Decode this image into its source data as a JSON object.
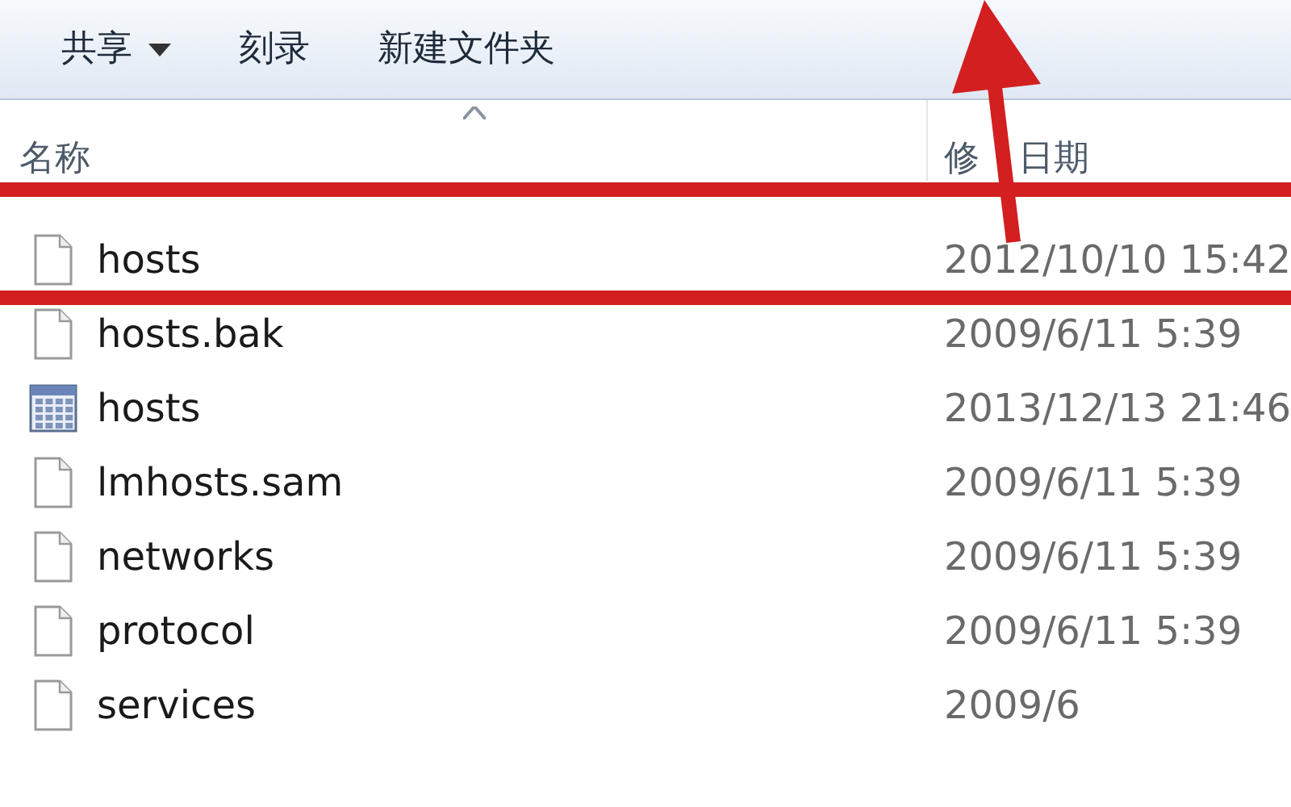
{
  "toolbar": [
    {
      "label": "共享",
      "has_menu": true
    },
    {
      "label": "刻录",
      "has_menu": false
    },
    {
      "label": "新建文件夹",
      "has_menu": false
    }
  ],
  "columns": [
    {
      "label_parts": [
        "名称"
      ],
      "sorted": true
    },
    {
      "label_parts": [
        "修",
        "日期"
      ],
      "sorted": false
    }
  ],
  "files": [
    {
      "name": "hosts",
      "modified": "2012/10/10 15:42",
      "kind": "file"
    },
    {
      "name": "hosts.bak",
      "modified": "2009/6/11 5:39",
      "kind": "file"
    },
    {
      "name": "hosts",
      "modified": "2013/12/13 21:46",
      "kind": "calendar"
    },
    {
      "name": "lmhosts.sam",
      "modified": "2009/6/11 5:39",
      "kind": "file"
    },
    {
      "name": "networks",
      "modified": "2009/6/11 5:39",
      "kind": "file"
    },
    {
      "name": "protocol",
      "modified": "2009/6/11 5:39",
      "kind": "file"
    },
    {
      "name": "services",
      "modified": "2009/6",
      "kind": "file"
    }
  ]
}
